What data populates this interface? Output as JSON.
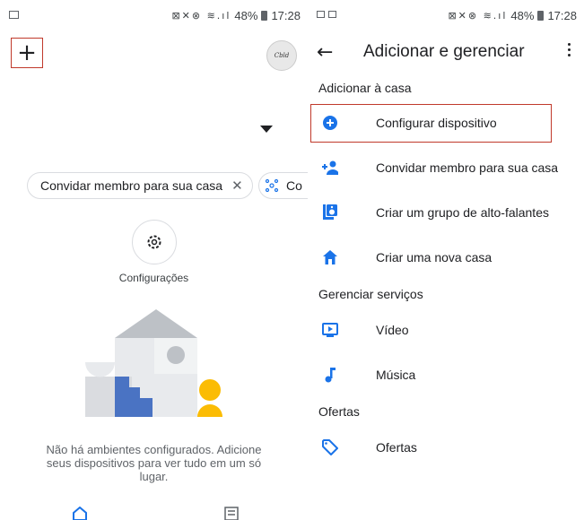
{
  "status_bar": {
    "battery": "48%",
    "time": "17:28"
  },
  "home_screen": {
    "chips": {
      "invite_label": "Convidar membro para sua casa",
      "second_partial": "Co"
    },
    "settings_label": "Configurações",
    "empty_message": "Não há ambientes configurados. Adicione seus dispositivos para ver tudo em um só lugar."
  },
  "add_manage": {
    "title": "Adicionar e gerenciar",
    "sections": {
      "add": "Adicionar à casa",
      "manage": "Gerenciar serviços",
      "offers": "Ofertas"
    },
    "items": [
      {
        "icon": "add-circle-icon",
        "label": "Configurar dispositivo"
      },
      {
        "icon": "person-add-icon",
        "label": "Convidar membro para sua casa"
      },
      {
        "icon": "speaker-group-icon",
        "label": "Criar um grupo de alto-falantes"
      },
      {
        "icon": "home-icon",
        "label": "Criar uma nova casa"
      },
      {
        "icon": "video-icon",
        "label": "Vídeo"
      },
      {
        "icon": "music-note-icon",
        "label": "Música"
      },
      {
        "icon": "tag-icon",
        "label": "Ofertas"
      }
    ]
  },
  "colors": {
    "accent_blue": "#1a73e8",
    "highlight_red": "#c0392b"
  }
}
